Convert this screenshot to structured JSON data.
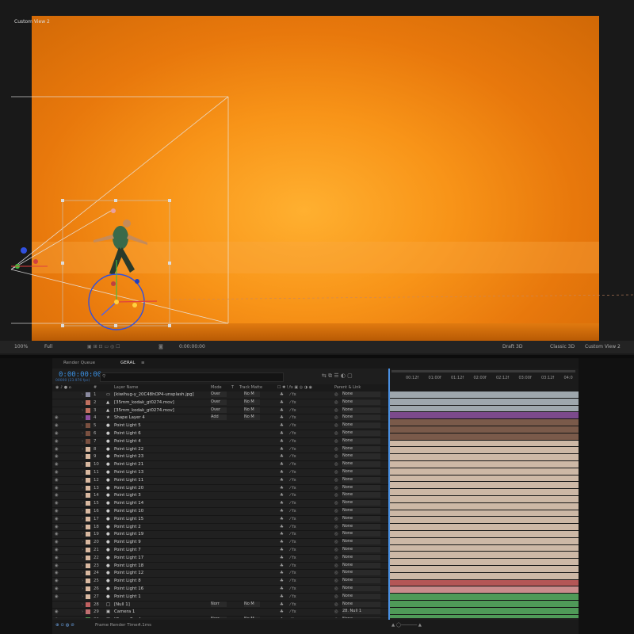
{
  "viewer": {
    "view_name": "Custom View 2",
    "zoom": "100%",
    "resolution": "Full",
    "timecode": "0:00:00:00",
    "renderer": "Draft 3D",
    "renderer_mode": "Classic 3D",
    "view_dropdown": "Custom View 2"
  },
  "timeline": {
    "tabs": [
      {
        "label": "Render Queue"
      },
      {
        "label": "GERAL"
      }
    ],
    "timecode": "0:00:00:00",
    "fps": "00000 (23.976 fps)",
    "columns": {
      "layer_name": "Layer Name",
      "mode": "Mode",
      "t": "T",
      "track_matte": "Track Matte",
      "parent": "Parent & Link"
    },
    "ruler": [
      "00:12f",
      "01:00f",
      "01:12f",
      "02:00f",
      "02:12f",
      "03:00f",
      "03:12f",
      "04:0"
    ],
    "footer": "Frame Render Time:",
    "footer_value": "4.1ms",
    "layers": [
      {
        "num": "1",
        "name": "[kiwihug-y_20C48hOP4-unsplash.jpg]",
        "icon": "▭",
        "mode": "Over",
        "matte": "No M",
        "parent": "None",
        "color": "#8a8aa0",
        "bar": "#9ea7ad",
        "eye": ""
      },
      {
        "num": "2",
        "name": "[35mm_kodak_gt0274.mov]",
        "icon": "▲",
        "mode": "Over",
        "matte": "No M",
        "parent": "None",
        "color": "#c07060",
        "bar": "#9ea7ad",
        "eye": ""
      },
      {
        "num": "3",
        "name": "[35mm_kodak_gt0274.mov]",
        "icon": "▲",
        "mode": "Over",
        "matte": "No M",
        "parent": "None",
        "color": "#c07060",
        "bar": "#9ea7ad",
        "eye": ""
      },
      {
        "num": "4",
        "name": "Shape Layer 4",
        "icon": "★",
        "mode": "Add",
        "matte": "No M",
        "parent": "None",
        "color": "#9050a0",
        "bar": "#7c4a8c",
        "eye": "◉"
      },
      {
        "num": "5",
        "name": "Point Light 5",
        "icon": "●",
        "mode": "",
        "matte": "",
        "parent": "None",
        "color": "#7a5040",
        "bar": "#7a5a4a",
        "eye": "◉"
      },
      {
        "num": "6",
        "name": "Point Light 6",
        "icon": "●",
        "mode": "",
        "matte": "",
        "parent": "None",
        "color": "#7a5040",
        "bar": "#7a5a4a",
        "eye": "◉"
      },
      {
        "num": "7",
        "name": "Point Light 4",
        "icon": "●",
        "mode": "",
        "matte": "",
        "parent": "None",
        "color": "#7a5040",
        "bar": "#7a5a4a",
        "eye": "◉"
      },
      {
        "num": "8",
        "name": "Point Light 22",
        "icon": "●",
        "mode": "",
        "matte": "",
        "parent": "None",
        "color": "#d8b8a0",
        "bar": "#cdb8a6",
        "eye": "◉"
      },
      {
        "num": "9",
        "name": "Point Light 23",
        "icon": "●",
        "mode": "",
        "matte": "",
        "parent": "None",
        "color": "#d8b8a0",
        "bar": "#cdb8a6",
        "eye": "◉"
      },
      {
        "num": "10",
        "name": "Point Light 21",
        "icon": "●",
        "mode": "",
        "matte": "",
        "parent": "None",
        "color": "#d8b8a0",
        "bar": "#cdb8a6",
        "eye": "◉"
      },
      {
        "num": "11",
        "name": "Point Light 13",
        "icon": "●",
        "mode": "",
        "matte": "",
        "parent": "None",
        "color": "#d8b8a0",
        "bar": "#cdb8a6",
        "eye": "◉"
      },
      {
        "num": "12",
        "name": "Point Light 11",
        "icon": "●",
        "mode": "",
        "matte": "",
        "parent": "None",
        "color": "#d8b8a0",
        "bar": "#cdb8a6",
        "eye": "◉"
      },
      {
        "num": "13",
        "name": "Point Light 20",
        "icon": "●",
        "mode": "",
        "matte": "",
        "parent": "None",
        "color": "#d8b8a0",
        "bar": "#cdb8a6",
        "eye": "◉"
      },
      {
        "num": "14",
        "name": "Point Light 3",
        "icon": "●",
        "mode": "",
        "matte": "",
        "parent": "None",
        "color": "#d8b8a0",
        "bar": "#cdb8a6",
        "eye": "◉"
      },
      {
        "num": "15",
        "name": "Point Light 14",
        "icon": "●",
        "mode": "",
        "matte": "",
        "parent": "None",
        "color": "#d8b8a0",
        "bar": "#cdb8a6",
        "eye": "◉"
      },
      {
        "num": "16",
        "name": "Point Light 10",
        "icon": "●",
        "mode": "",
        "matte": "",
        "parent": "None",
        "color": "#d8b8a0",
        "bar": "#cdb8a6",
        "eye": "◉"
      },
      {
        "num": "17",
        "name": "Point Light 15",
        "icon": "●",
        "mode": "",
        "matte": "",
        "parent": "None",
        "color": "#d8b8a0",
        "bar": "#cdb8a6",
        "eye": "◉"
      },
      {
        "num": "18",
        "name": "Point Light 2",
        "icon": "●",
        "mode": "",
        "matte": "",
        "parent": "None",
        "color": "#d8b8a0",
        "bar": "#cdb8a6",
        "eye": "◉"
      },
      {
        "num": "19",
        "name": "Point Light 19",
        "icon": "●",
        "mode": "",
        "matte": "",
        "parent": "None",
        "color": "#d8b8a0",
        "bar": "#cdb8a6",
        "eye": "◉"
      },
      {
        "num": "20",
        "name": "Point Light 9",
        "icon": "●",
        "mode": "",
        "matte": "",
        "parent": "None",
        "color": "#d8b8a0",
        "bar": "#cdb8a6",
        "eye": "◉"
      },
      {
        "num": "21",
        "name": "Point Light 7",
        "icon": "●",
        "mode": "",
        "matte": "",
        "parent": "None",
        "color": "#d8b8a0",
        "bar": "#cdb8a6",
        "eye": "◉"
      },
      {
        "num": "22",
        "name": "Point Light 17",
        "icon": "●",
        "mode": "",
        "matte": "",
        "parent": "None",
        "color": "#d8b8a0",
        "bar": "#cdb8a6",
        "eye": "◉"
      },
      {
        "num": "23",
        "name": "Point Light 18",
        "icon": "●",
        "mode": "",
        "matte": "",
        "parent": "None",
        "color": "#d8b8a0",
        "bar": "#cdb8a6",
        "eye": "◉"
      },
      {
        "num": "24",
        "name": "Point Light 12",
        "icon": "●",
        "mode": "",
        "matte": "",
        "parent": "None",
        "color": "#d8b8a0",
        "bar": "#cdb8a6",
        "eye": "◉"
      },
      {
        "num": "25",
        "name": "Point Light 8",
        "icon": "●",
        "mode": "",
        "matte": "",
        "parent": "None",
        "color": "#d8b8a0",
        "bar": "#cdb8a6",
        "eye": "◉"
      },
      {
        "num": "26",
        "name": "Point Light 16",
        "icon": "●",
        "mode": "",
        "matte": "",
        "parent": "None",
        "color": "#d8b8a0",
        "bar": "#cdb8a6",
        "eye": "◉"
      },
      {
        "num": "27",
        "name": "Point Light 1",
        "icon": "●",
        "mode": "",
        "matte": "",
        "parent": "None",
        "color": "#d8b8a0",
        "bar": "#cdb8a6",
        "eye": "◉"
      },
      {
        "num": "28",
        "name": "[Null 1]",
        "icon": "□",
        "mode": "Norr",
        "matte": "No M",
        "parent": "None",
        "color": "#c06060",
        "bar": "#b45656",
        "eye": ""
      },
      {
        "num": "29",
        "name": "Camera 1",
        "icon": "▣",
        "mode": "",
        "matte": "",
        "parent": "28. Null 1",
        "color": "#c07070",
        "bar": "#c98c8c",
        "eye": "◉"
      },
      {
        "num": "30",
        "name": "[Grass_Row]",
        "icon": "▦",
        "mode": "Norr",
        "matte": "No M",
        "parent": "None",
        "color": "#50a050",
        "bar": "#4f9a58",
        "eye": "◉"
      },
      {
        "num": "31",
        "name": "[Grass_Row]",
        "icon": "▦",
        "mode": "Norr",
        "matte": "No M",
        "parent": "None",
        "color": "#50a050",
        "bar": "#4f9a58",
        "eye": "◉"
      },
      {
        "num": "32",
        "name": "[Grass_Row]",
        "icon": "▦",
        "mode": "Norr",
        "matte": "No M",
        "parent": "None",
        "color": "#50a050",
        "bar": "#4f9a58",
        "eye": "◉"
      },
      {
        "num": "33",
        "name": "[Grass_Row]",
        "icon": "▦",
        "mode": "Norr",
        "matte": "No M",
        "parent": "None",
        "color": "#50a050",
        "bar": "#4f9a58",
        "eye": "◉"
      }
    ]
  }
}
